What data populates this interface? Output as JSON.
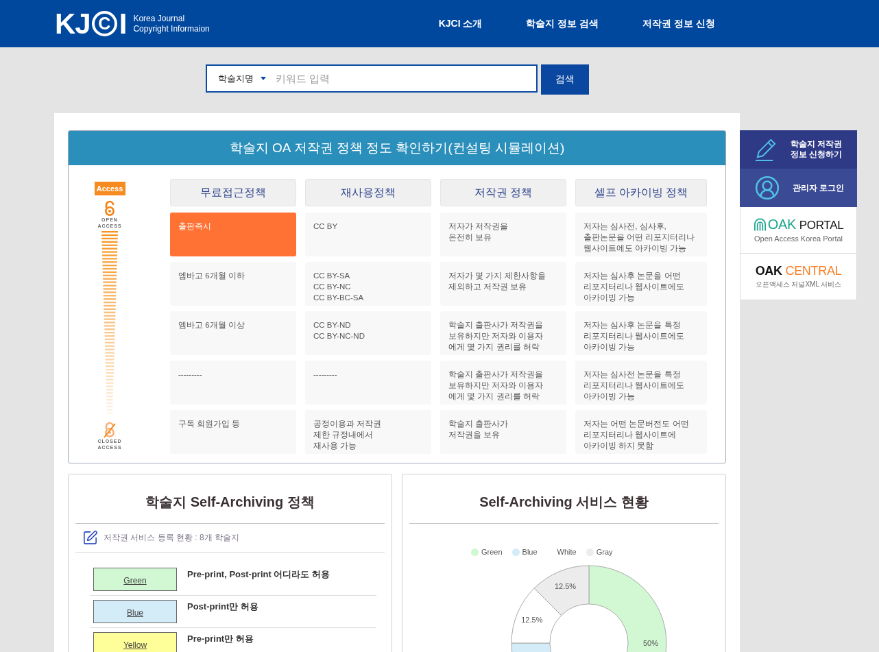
{
  "header": {
    "logo": {
      "letters": "KJ",
      "ringed_letter": "C",
      "last_letter": "I",
      "tagline": "Korea Journal\nCopyright Informaion"
    },
    "nav": [
      {
        "label": "KJCI 소개"
      },
      {
        "label": "학술지 정보 검색"
      },
      {
        "label": "저작권 정보 신청"
      }
    ]
  },
  "search": {
    "category": "학술지명",
    "placeholder": "키워드 입력",
    "button": "검색"
  },
  "policy_table": {
    "title": "학술지 OA 저작권 정책 정도 확인하기(컨설팅 시뮬레이션)",
    "access_scale": {
      "badge": "Access",
      "top_label": "OPEN ACCESS",
      "bottom_label": "CLOSED ACCESS"
    },
    "columns": [
      "무료접근정책",
      "재사용정책",
      "저작권 정책",
      "셀프 아카이빙 정책"
    ],
    "rows": [
      {
        "cells": [
          {
            "text": "출판즉시",
            "selected": true
          },
          {
            "text": "CC BY",
            "selected": false
          },
          {
            "text": "저자가 저작권을\n온전히 보유",
            "selected": false
          },
          {
            "text": "저자는 심사전, 심사후,\n출판논문을 어떤 리포지터리나\n웹사이트에도 아카이빙 가능",
            "selected": false
          }
        ]
      },
      {
        "cells": [
          {
            "text": "엠바고 6개월 이하",
            "selected": false
          },
          {
            "text": "CC BY-SA\nCC BY-NC\nCC BY-BC-SA",
            "selected": false
          },
          {
            "text": "저자가 몇 가지 제한사항을\n제외하고 저작권 보유",
            "selected": false
          },
          {
            "text": "저자는 심사후 논문을 어떤\n리포지터리나 웹사이트에도\n아카이빙 가능",
            "selected": false
          }
        ]
      },
      {
        "cells": [
          {
            "text": "엠바고 6개월 이상",
            "selected": false
          },
          {
            "text": "CC BY-ND\nCC BY-NC-ND",
            "selected": false
          },
          {
            "text": "학술지 출판사가 저작권을\n보유하지만 저자와 이용자\n에게 몇 가지 권리를 허락",
            "selected": false
          },
          {
            "text": "저자는 심사후 논문을 특정\n리포지터리나 웹사이트에도\n아카이빙 가능",
            "selected": false
          }
        ]
      },
      {
        "cells": [
          {
            "text": "---------",
            "selected": false
          },
          {
            "text": "---------",
            "selected": false
          },
          {
            "text": "학술지 출판사가 저작권을\n보유하지만 저자와 이용자\n에게 몇 가지 권리를 허락",
            "selected": false
          },
          {
            "text": "저자는 심사전 논문을 특정\n리포지터리나 웹사이트에도\n아카이빙 가능",
            "selected": false
          }
        ]
      },
      {
        "cells": [
          {
            "text": "구독 회원가입 등",
            "selected": false
          },
          {
            "text": "공정이용과 저작권\n제한 규정내에서\n재사용 가능",
            "selected": false
          },
          {
            "text": "학술지 출판사가\n저작권을 보유",
            "selected": false
          },
          {
            "text": "저자는 어떤 논문버전도 어떤\n리포지터리나 웹사이트에\n아카이빙 하지 못함",
            "selected": false
          }
        ]
      }
    ]
  },
  "sidebar": {
    "items": [
      {
        "kind": "apply",
        "label": "학술지 저작권\n정보 신청하기"
      },
      {
        "kind": "login",
        "label": "관리자 로그인"
      },
      {
        "kind": "portal",
        "brand": "OAK",
        "name": "PORTAL",
        "subtitle": "Open Access Korea Portal"
      },
      {
        "kind": "central",
        "brand": "OAK",
        "name": "CENTRAL",
        "subtitle": "오픈액세스 저널XML 서비스"
      }
    ]
  },
  "self_archiving_policy": {
    "title": "학술지 Self-Archiving 정책",
    "summary": "저작권 서비스 등록 현황 : 8개 학술지",
    "levels": [
      {
        "label": "Green",
        "color": "#d1f8d3",
        "description": "Pre-print, Post-print 어디라도 허용"
      },
      {
        "label": "Blue",
        "color": "#d4ebf8",
        "description": "Post-print만 허용"
      },
      {
        "label": "Yellow",
        "color": "#ffff99",
        "description": "Pre-print만 허용"
      }
    ]
  },
  "self_archiving_status": {
    "title": "Self-Archiving 서비스 현황",
    "chart_data": {
      "type": "donut",
      "categories": [
        "Green",
        "Blue",
        "White",
        "Gray"
      ],
      "colors": [
        "#d1f8d3",
        "#d4ebf8",
        "#ffffff",
        "#ececec"
      ],
      "values": [
        50,
        25,
        12.5,
        12.5
      ],
      "value_labels": [
        "50%",
        null,
        "12.5%",
        "12.5%"
      ]
    }
  }
}
